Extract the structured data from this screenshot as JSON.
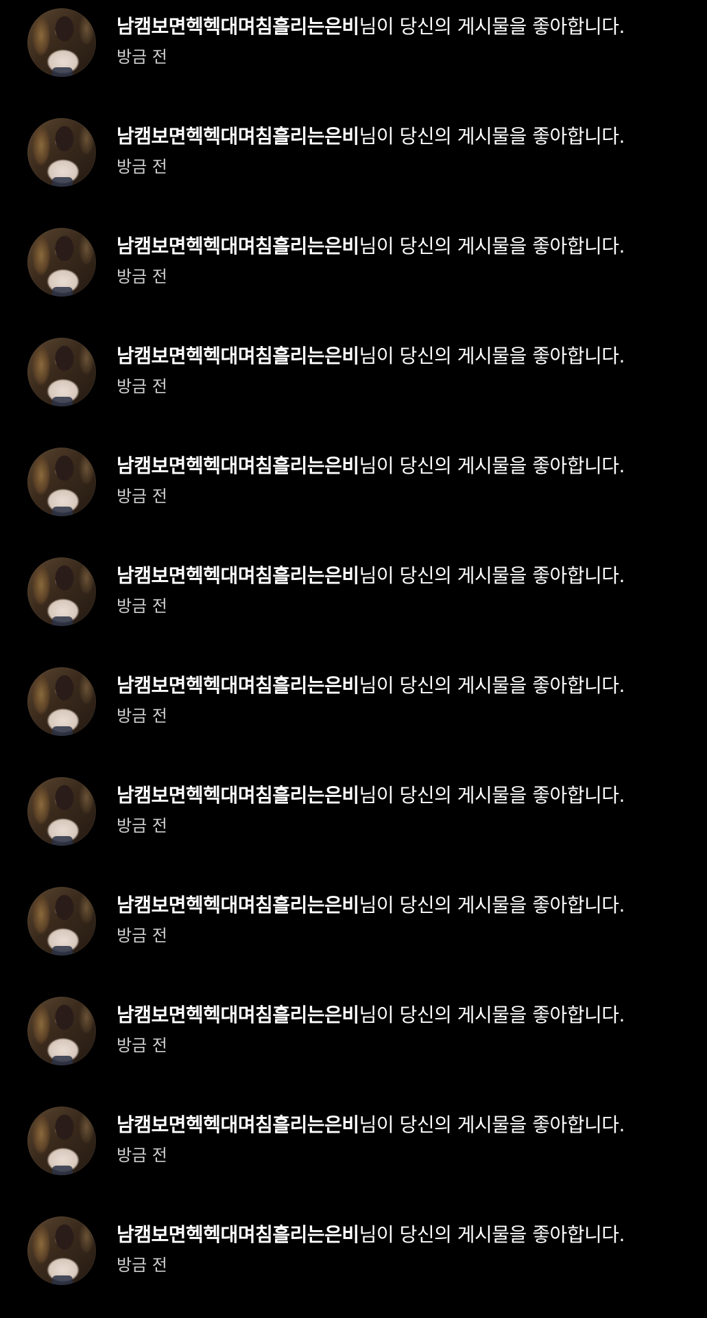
{
  "notifications": [
    {
      "username": "남캠보면헥헥대며침흘리는은비",
      "message": "님이 당신의 게시물을 좋아합니다.",
      "time": "방금 전"
    },
    {
      "username": "남캠보면헥헥대며침흘리는은비",
      "message": "님이 당신의 게시물을 좋아합니다.",
      "time": "방금 전"
    },
    {
      "username": "남캠보면헥헥대며침흘리는은비",
      "message": "님이 당신의 게시물을 좋아합니다.",
      "time": "방금 전"
    },
    {
      "username": "남캠보면헥헥대며침흘리는은비",
      "message": "님이 당신의 게시물을 좋아합니다.",
      "time": "방금 전"
    },
    {
      "username": "남캠보면헥헥대며침흘리는은비",
      "message": "님이 당신의 게시물을 좋아합니다.",
      "time": "방금 전"
    },
    {
      "username": "남캠보면헥헥대며침흘리는은비",
      "message": "님이 당신의 게시물을 좋아합니다.",
      "time": "방금 전"
    },
    {
      "username": "남캠보면헥헥대며침흘리는은비",
      "message": "님이 당신의 게시물을 좋아합니다.",
      "time": "방금 전"
    },
    {
      "username": "남캠보면헥헥대며침흘리는은비",
      "message": "님이 당신의 게시물을 좋아합니다.",
      "time": "방금 전"
    },
    {
      "username": "남캠보면헥헥대며침흘리는은비",
      "message": "님이 당신의 게시물을 좋아합니다.",
      "time": "방금 전"
    },
    {
      "username": "남캠보면헥헥대며침흘리는은비",
      "message": "님이 당신의 게시물을 좋아합니다.",
      "time": "방금 전"
    },
    {
      "username": "남캠보면헥헥대며침흘리는은비",
      "message": "님이 당신의 게시물을 좋아합니다.",
      "time": "방금 전"
    },
    {
      "username": "남캠보면헥헥대며침흘리는은비",
      "message": "님이 당신의 게시물을 좋아합니다.",
      "time": "방금 전"
    }
  ],
  "colors": {
    "background": "#000000",
    "text": "#ffffff",
    "time_text": "#d0d0d0"
  }
}
